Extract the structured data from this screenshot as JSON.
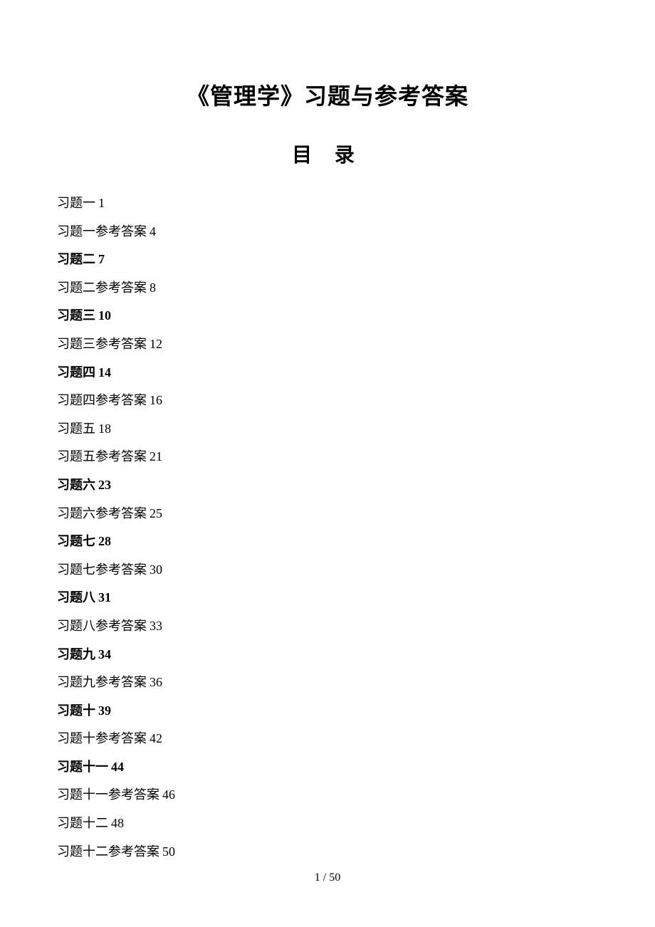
{
  "title": "《管理学》习题与参考答案",
  "subtitle": "目 录",
  "toc": [
    {
      "label": "习题一",
      "page": "1",
      "bold": false
    },
    {
      "label": "习题一参考答案",
      "page": "4",
      "bold": false
    },
    {
      "label": "习题二",
      "page": "7",
      "bold": true
    },
    {
      "label": "习题二参考答案",
      "page": "8",
      "bold": false
    },
    {
      "label": "习题三",
      "page": "10",
      "bold": true
    },
    {
      "label": "习题三参考答案",
      "page": "12",
      "bold": false
    },
    {
      "label": "习题四",
      "page": "14",
      "bold": true
    },
    {
      "label": "习题四参考答案",
      "page": "16",
      "bold": false
    },
    {
      "label": "习题五",
      "page": "18",
      "bold": false
    },
    {
      "label": "习题五参考答案",
      "page": "21",
      "bold": false
    },
    {
      "label": "习题六",
      "page": "23",
      "bold": true
    },
    {
      "label": "习题六参考答案",
      "page": "25",
      "bold": false
    },
    {
      "label": "习题七",
      "page": "28",
      "bold": true
    },
    {
      "label": "习题七参考答案",
      "page": "30",
      "bold": false
    },
    {
      "label": "习题八",
      "page": "31",
      "bold": true
    },
    {
      "label": "习题八参考答案",
      "page": "33",
      "bold": false
    },
    {
      "label": "习题九",
      "page": "34",
      "bold": true
    },
    {
      "label": "习题九参考答案",
      "page": "36",
      "bold": false
    },
    {
      "label": "习题十",
      "page": "39",
      "bold": true
    },
    {
      "label": "习题十参考答案",
      "page": "42",
      "bold": false
    },
    {
      "label": "习题十一",
      "page": "44",
      "bold": true
    },
    {
      "label": "习题十一参考答案",
      "page": "46",
      "bold": false
    },
    {
      "label": "习题十二",
      "page": "48",
      "bold": false
    },
    {
      "label": "习题十二参考答案",
      "page": "50",
      "bold": false
    }
  ],
  "footer": "1 / 50"
}
